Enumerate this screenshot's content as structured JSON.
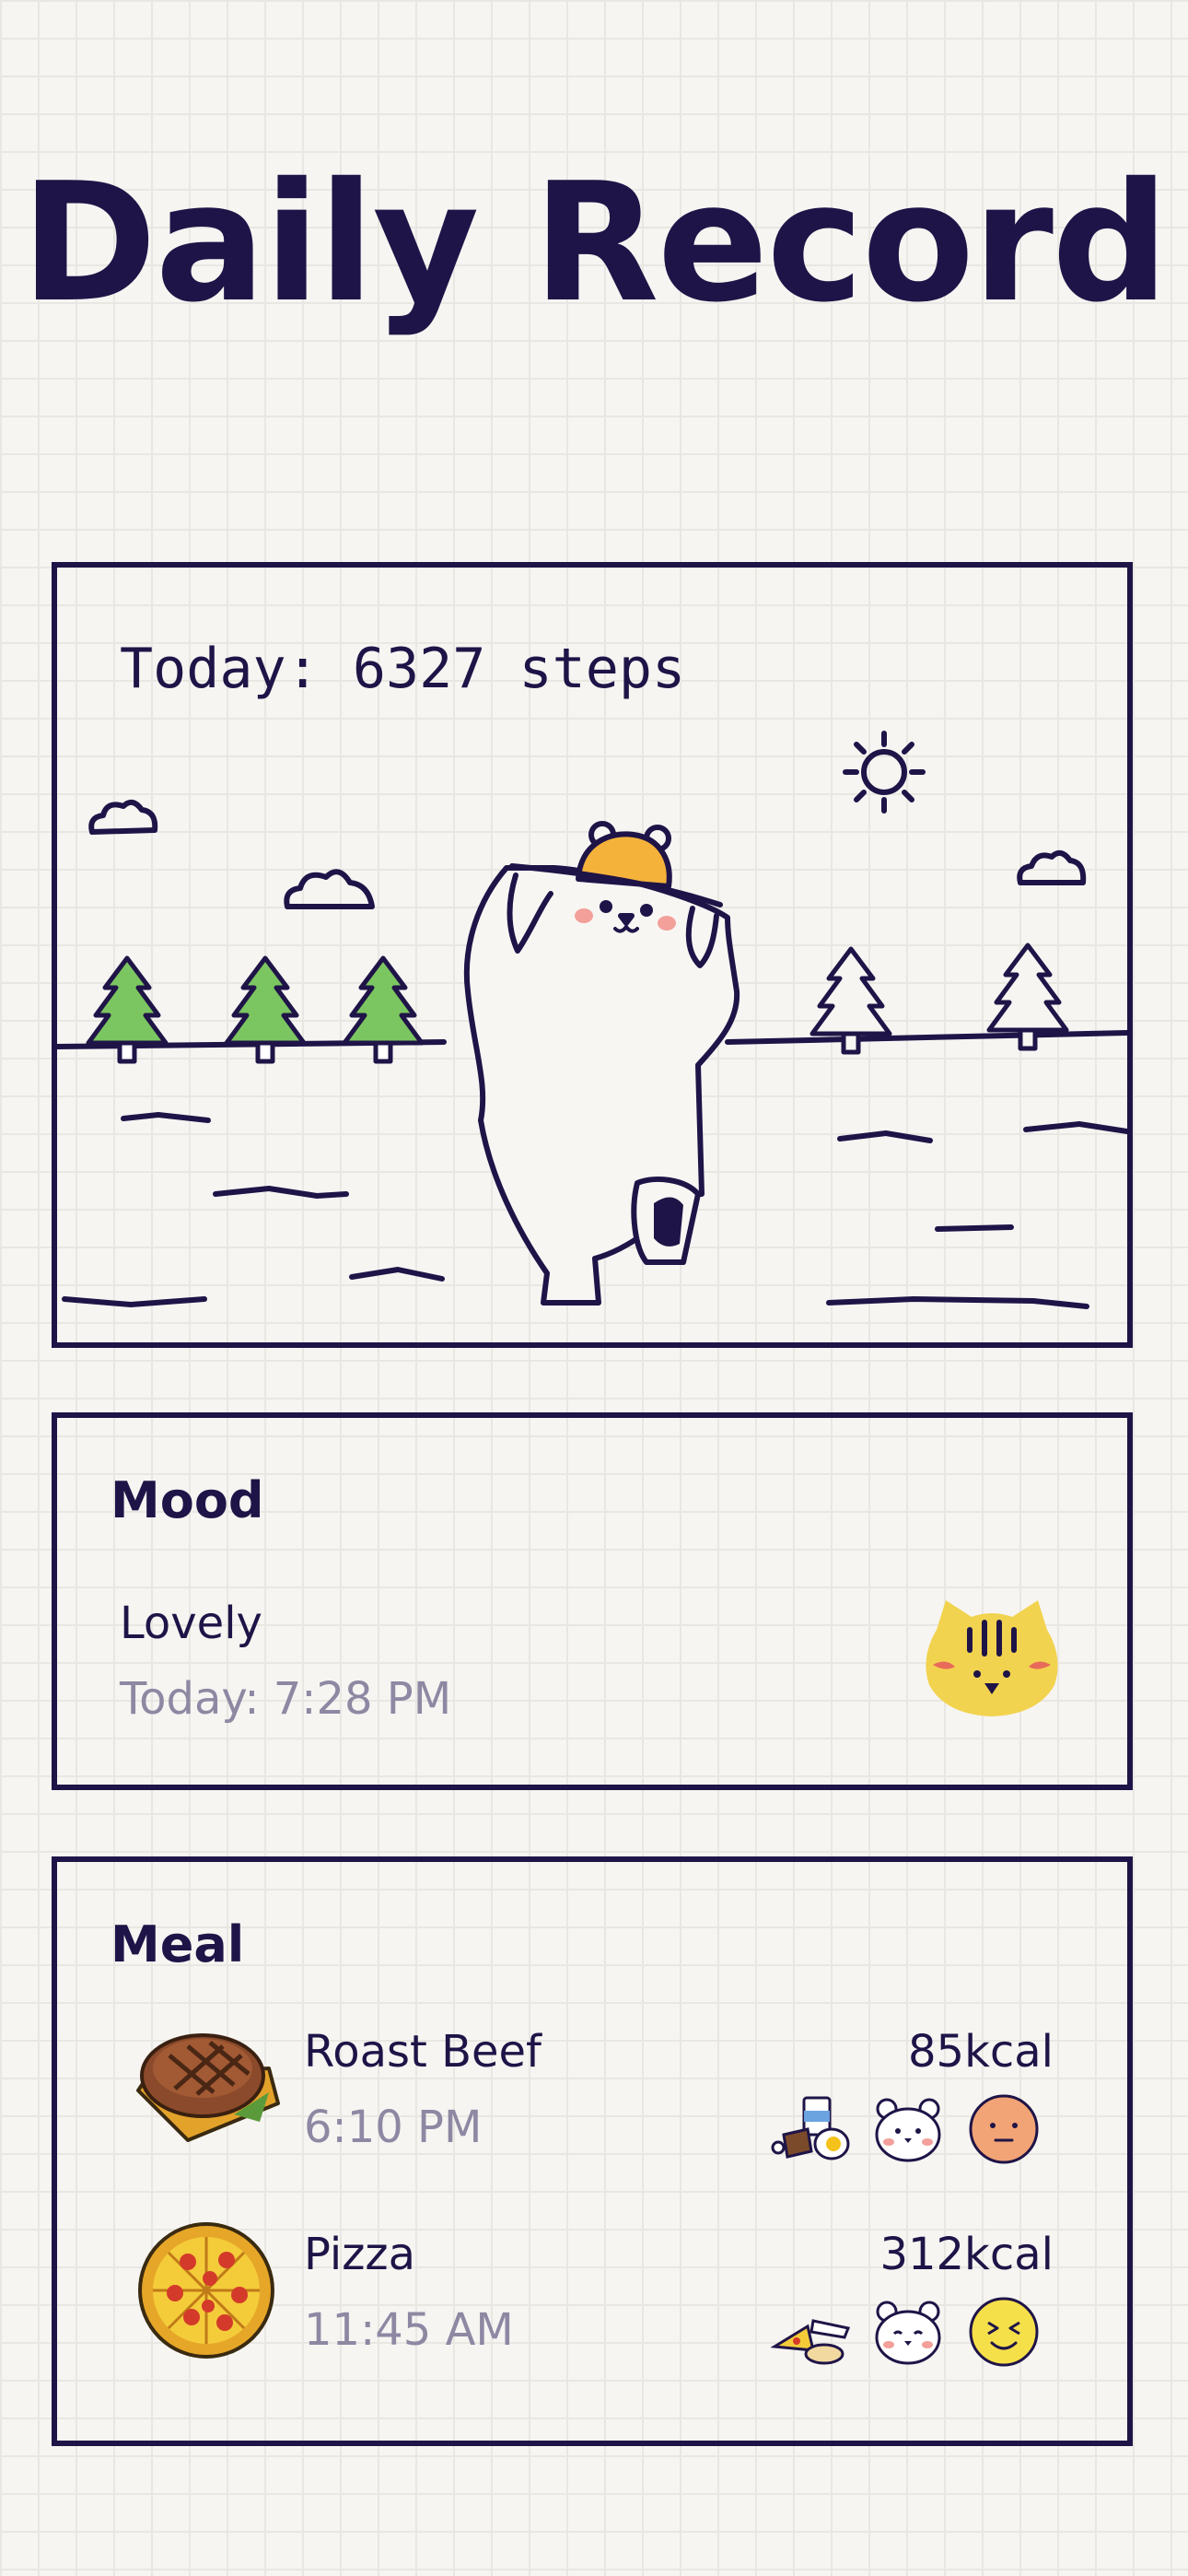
{
  "header": {
    "title": "Daily Record"
  },
  "steps": {
    "text": "Today: 6327 steps"
  },
  "mood": {
    "title": "Mood",
    "label": "Lovely",
    "time": "Today: 7:28 PM",
    "avatar_icon": "tiger-face-icon"
  },
  "meal": {
    "title": "Meal",
    "items": [
      {
        "name": "Roast Beef",
        "time": "6:10 PM",
        "kcal": "85kcal",
        "image_icon": "steak-icon",
        "tags": [
          "breakfast-food-icon",
          "bear-face-icon",
          "neutral-face-icon"
        ]
      },
      {
        "name": "Pizza",
        "time": "11:45 AM",
        "kcal": "312kcal",
        "image_icon": "pizza-icon",
        "tags": [
          "lunch-food-icon",
          "bear-face-icon",
          "laughing-face-icon"
        ]
      }
    ]
  },
  "colors": {
    "ink": "#1f1447",
    "muted": "#8e88a3",
    "tree": "#7cc661",
    "hat": "#f4b23a",
    "tiger": "#f2d34f",
    "blush": "#f3a09a",
    "background": "#f6f5f2"
  }
}
